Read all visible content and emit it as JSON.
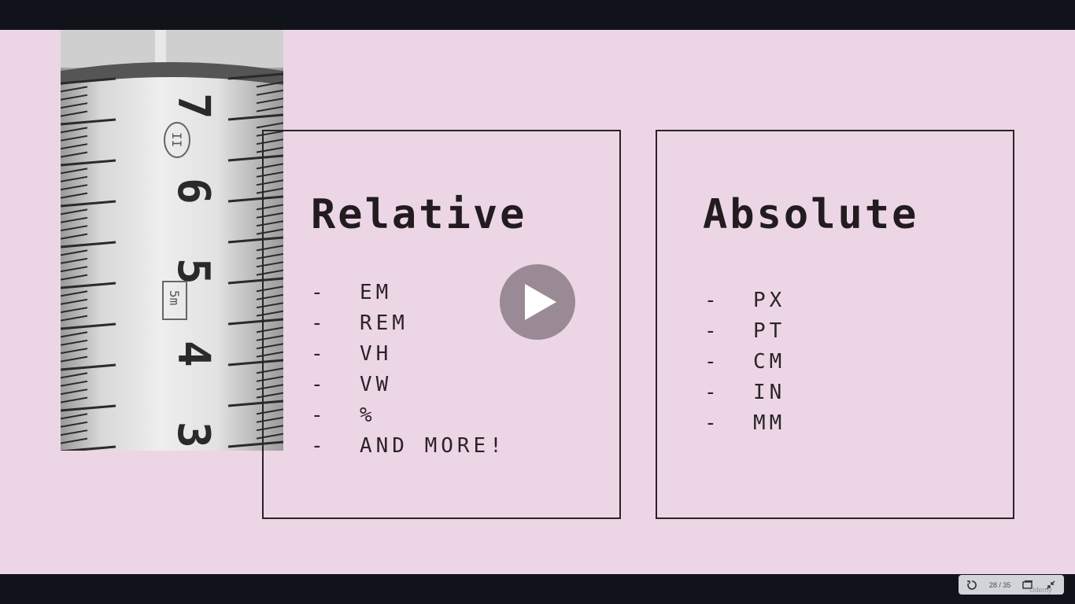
{
  "slide": {
    "relative": {
      "title": "Relative",
      "items": [
        "-  EM",
        "-  REM",
        "-  VH",
        "-  VW",
        "-  %",
        "-  AND MORE!"
      ]
    },
    "absolute": {
      "title": "Absolute",
      "items": [
        "-  PX",
        "-  PT",
        "-  CM",
        "-  IN",
        "-  MM"
      ]
    },
    "tape_numbers": [
      "7",
      "6",
      "5",
      "4",
      "3"
    ],
    "tape_marks": [
      "II",
      "5m"
    ]
  },
  "player": {
    "slide_counter": "28 / 35",
    "watermark": "Udemy"
  },
  "colors": {
    "slide_background": "#ecd6e5",
    "frame_background": "#10131a",
    "text": "#221c20",
    "play_button": "#8c7d87"
  },
  "icons": {
    "play": "play-icon",
    "replay": "replay-icon",
    "captions": "screen-icon",
    "fullscreen": "exit-fullscreen-icon"
  }
}
